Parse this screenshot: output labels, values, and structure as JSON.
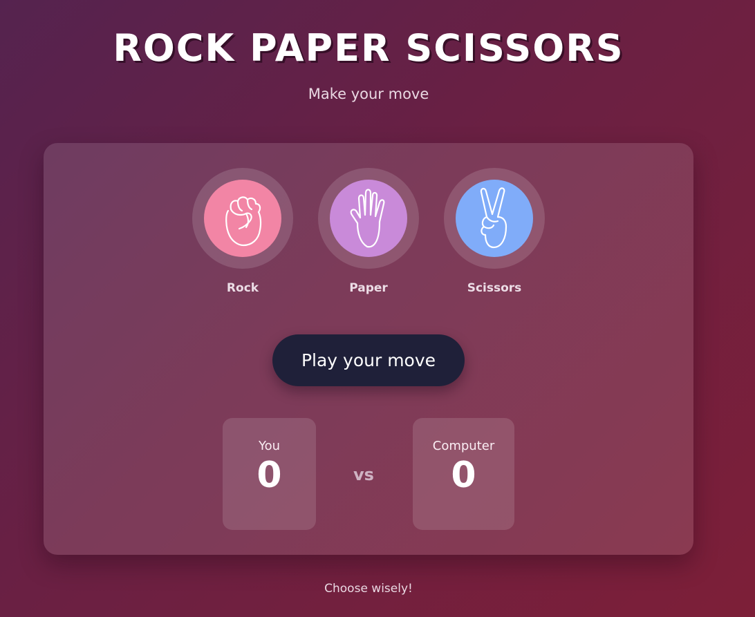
{
  "header": {
    "title": "ROCK PAPER SCISSORS",
    "subtitle": "Make your move"
  },
  "choices": [
    {
      "label": "Rock",
      "icon": "fist-icon",
      "color": "#f285a5"
    },
    {
      "label": "Paper",
      "icon": "open-hand-icon",
      "color": "#c98ad9"
    },
    {
      "label": "Scissors",
      "icon": "peace-sign-icon",
      "color": "#80acf9"
    }
  ],
  "play_button": {
    "label": "Play your move"
  },
  "scoreboard": {
    "player_label": "You",
    "player_score": "0",
    "vs": "vs",
    "computer_label": "Computer",
    "computer_score": "0"
  },
  "footer": {
    "text": "Choose wisely!"
  },
  "colors": {
    "button_bg": "#1f2039",
    "background_start": "#55234f",
    "background_end": "#7d1f38"
  }
}
